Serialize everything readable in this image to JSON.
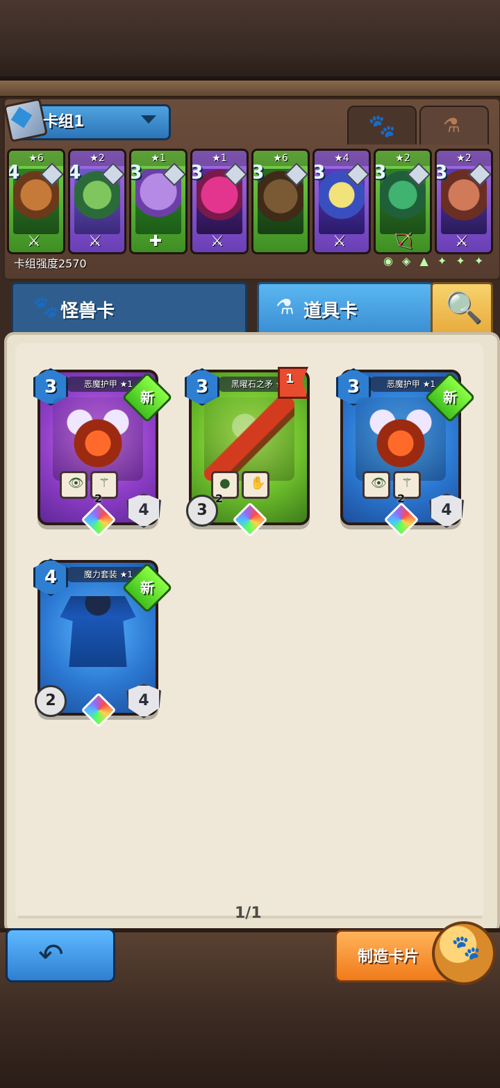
{
  "deck": {
    "name": "卡组1",
    "strength_label": "卡组强度2570"
  },
  "header_tabs": {
    "paw_tab_icon": "paw-icon",
    "potion_tab_icon": "potion-icon"
  },
  "mini_cards": [
    {
      "stars": "★6",
      "cost": "4",
      "tool": "⚔",
      "color": "green"
    },
    {
      "stars": "★2",
      "cost": "4",
      "tool": "⚔",
      "color": "purple"
    },
    {
      "stars": "★1",
      "cost": "3",
      "tool": "✚",
      "color": "green"
    },
    {
      "stars": "★1",
      "cost": "3",
      "tool": "⚔",
      "color": "purple"
    },
    {
      "stars": "★6",
      "cost": "3",
      "tool": "",
      "color": "green"
    },
    {
      "stars": "★4",
      "cost": "3",
      "tool": "⚔",
      "color": "purple"
    },
    {
      "stars": "★2",
      "cost": "3",
      "tool": "🏹",
      "color": "green"
    },
    {
      "stars": "★2",
      "cost": "3",
      "tool": "⚔",
      "color": "purple"
    }
  ],
  "tabs": {
    "monster_label": "怪兽卡",
    "item_label": "道具卡"
  },
  "cards": [
    {
      "title": "恶魔护甲 ★1",
      "cost": "3",
      "badge": "新",
      "shield": "4",
      "rune_count": "2",
      "kind": "demon",
      "color": "purple"
    },
    {
      "title": "黑曜石之矛 ★2",
      "cost": "3",
      "flag": "1",
      "damage": "3",
      "rune_count": "2",
      "kind": "spear",
      "color": "green"
    },
    {
      "title": "恶魔护甲 ★1",
      "cost": "3",
      "badge": "新",
      "shield": "4",
      "rune_count": "2",
      "kind": "demon",
      "color": "blue"
    },
    {
      "title": "魔力套装 ★1",
      "cost": "4",
      "badge": "新",
      "shield": "4",
      "damage": "2",
      "kind": "robe",
      "color": "blue"
    }
  ],
  "pagination": {
    "label": "1/1"
  },
  "buttons": {
    "make_label": "制造卡片"
  },
  "colors": {
    "accent_blue": "#2e7fd1",
    "accent_orange": "#f07a1a",
    "badge_green": "#3fbf1e",
    "panel_bg": "#efe8d8"
  }
}
